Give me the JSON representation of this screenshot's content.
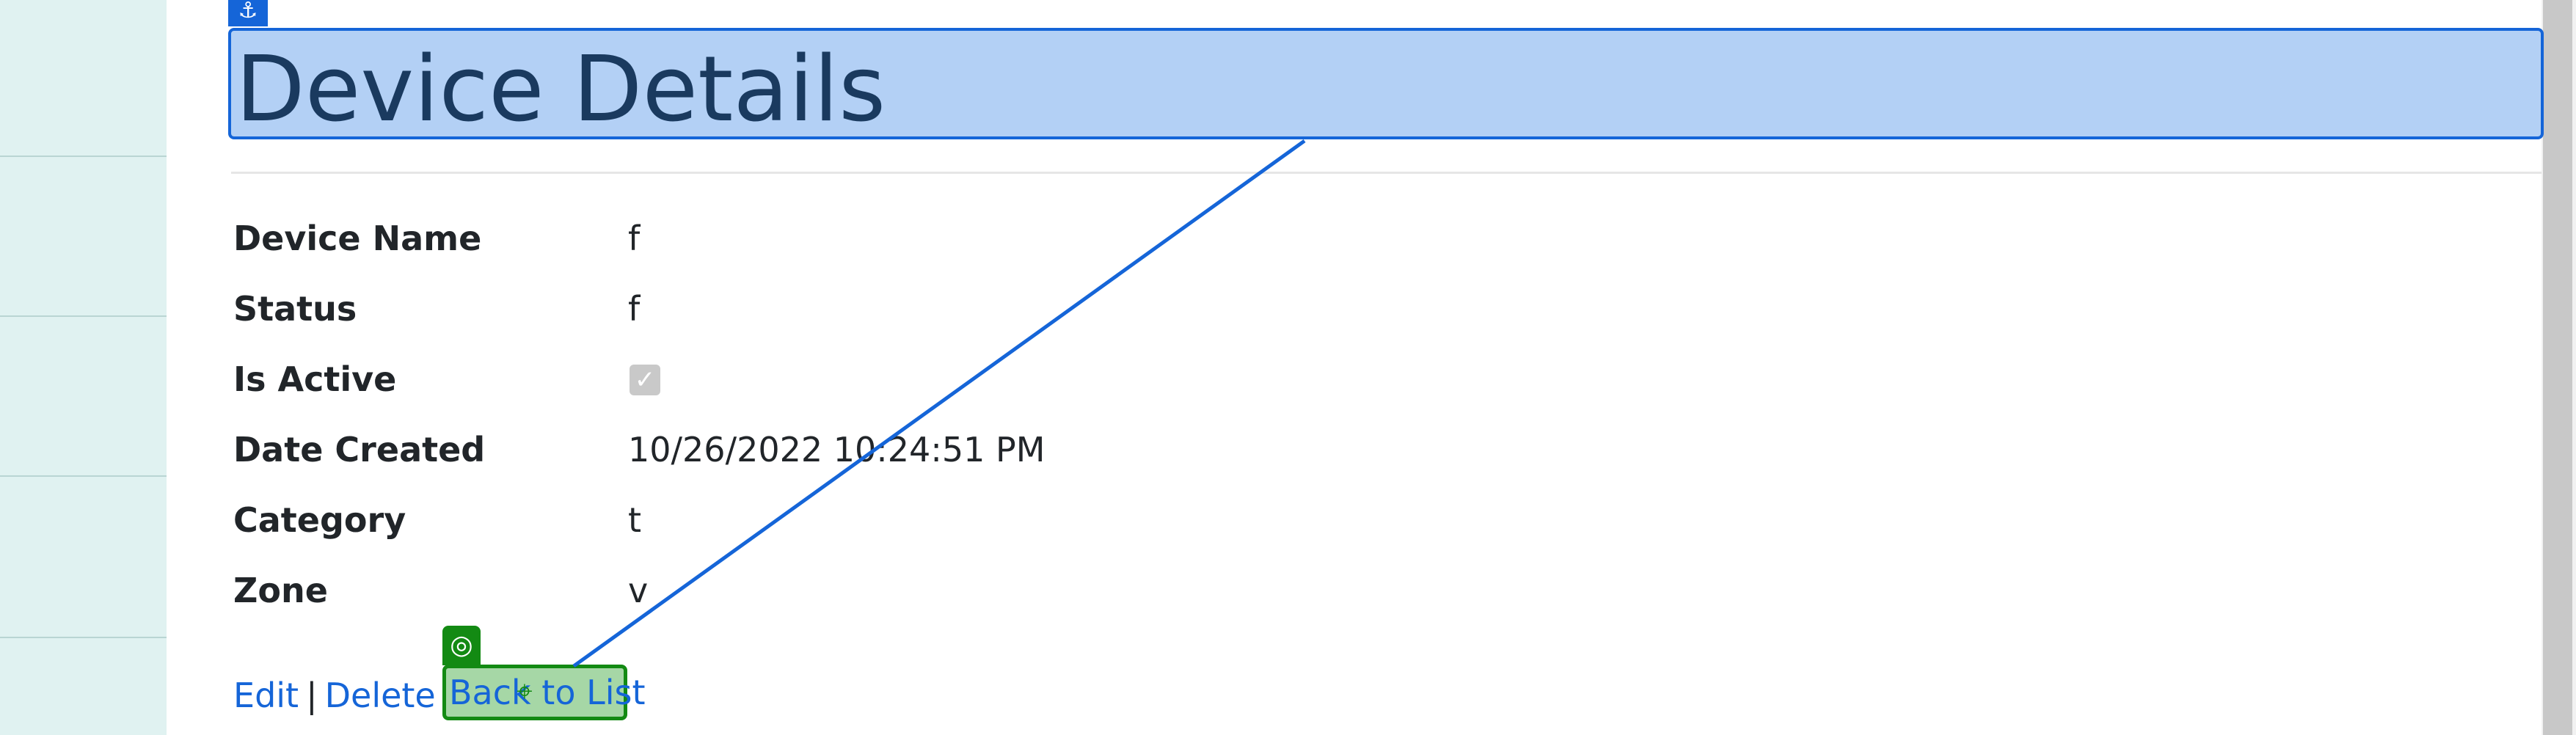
{
  "page": {
    "title": "Device Details"
  },
  "details": [
    {
      "label": "Device Name",
      "value": "f"
    },
    {
      "label": "Status",
      "value": "f"
    },
    {
      "label": "Is Active",
      "value": ""
    },
    {
      "label": "Date Created",
      "value": "10/26/2022 10:24:51 PM"
    },
    {
      "label": "Category",
      "value": "t"
    },
    {
      "label": "Zone",
      "value": "v"
    }
  ],
  "is_active_checked": true,
  "actions": {
    "edit": "Edit",
    "delete": "Delete",
    "back": "Back to List",
    "separator": "|"
  },
  "overlay": {
    "anchor_icon": "anchor-icon",
    "target_icon": "target-icon",
    "crosshair_icon": "crosshair-icon",
    "anchor_color": "#1565d8",
    "target_color": "#138a13"
  }
}
